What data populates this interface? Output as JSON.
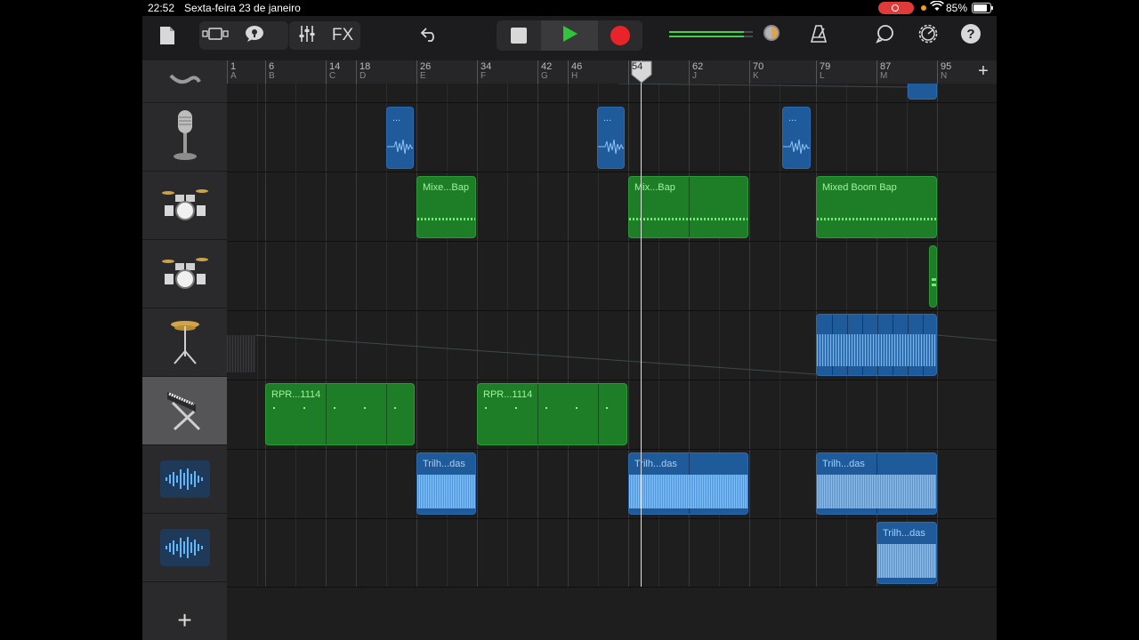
{
  "status_bar": {
    "time": "22:52",
    "date": "Sexta-feira 23 de janeiro",
    "battery": "85%",
    "recording_color": "#e03a3a"
  },
  "toolbar": {
    "buttons": [
      {
        "id": "my-songs",
        "icon": "document-icon"
      },
      {
        "id": "view-toggle",
        "icon": "tracks-view-icon"
      },
      {
        "id": "smart-controls",
        "icon": "speech-bubble-icon"
      },
      {
        "id": "mixer",
        "icon": "sliders-icon"
      },
      {
        "id": "fx",
        "label": "FX"
      },
      {
        "id": "undo",
        "icon": "undo-icon"
      },
      {
        "id": "stop",
        "icon": "stop-icon"
      },
      {
        "id": "play",
        "icon": "play-icon"
      },
      {
        "id": "record",
        "icon": "record-icon"
      },
      {
        "id": "metronome",
        "icon": "metronome-icon"
      },
      {
        "id": "loops",
        "icon": "loop-icon"
      },
      {
        "id": "settings",
        "icon": "gear-icon"
      },
      {
        "id": "help",
        "icon": "help-icon",
        "label": "?"
      }
    ],
    "fx_label": "FX",
    "help_label": "?",
    "accent_play": "#2fc63a",
    "accent_record": "#e8232a",
    "meter_level": 0.9
  },
  "ruler": {
    "marks": [
      {
        "num": "1",
        "letter": "A"
      },
      {
        "num": "6",
        "letter": "B"
      },
      {
        "num": "14",
        "letter": "C"
      },
      {
        "num": "18",
        "letter": "D"
      },
      {
        "num": "26",
        "letter": "E"
      },
      {
        "num": "34",
        "letter": "F"
      },
      {
        "num": "42",
        "letter": "G"
      },
      {
        "num": "46",
        "letter": "H"
      },
      {
        "num": "54",
        "letter": ""
      },
      {
        "num": "62",
        "letter": "J"
      },
      {
        "num": "70",
        "letter": "K"
      },
      {
        "num": "79",
        "letter": "L"
      },
      {
        "num": "87",
        "letter": "M"
      },
      {
        "num": "95",
        "letter": "N"
      }
    ],
    "playhead_bar": "54",
    "add_label": "+"
  },
  "tracks": [
    {
      "instrument": "partial-track-icon"
    },
    {
      "instrument": "microphone-icon"
    },
    {
      "instrument": "drum-kit-icon"
    },
    {
      "instrument": "drum-kit-icon"
    },
    {
      "instrument": "cymbal-icon"
    },
    {
      "instrument": "keyboard-icon",
      "selected": true
    },
    {
      "instrument": "audio-waveform-icon"
    },
    {
      "instrument": "audio-waveform-icon"
    }
  ],
  "regions": {
    "mic": [
      "...",
      "...",
      "..."
    ],
    "drums1": [
      "Mixe...Bap",
      "Mix...Bap",
      "Mixed Boom Bap"
    ],
    "keys": [
      "RPR...1114",
      "RPR...1114"
    ],
    "audio1": [
      "Trilh...das",
      "Trilh...das",
      "Trilh...das"
    ],
    "audio2": [
      "Trilh...das"
    ]
  },
  "add_track_label": "+"
}
